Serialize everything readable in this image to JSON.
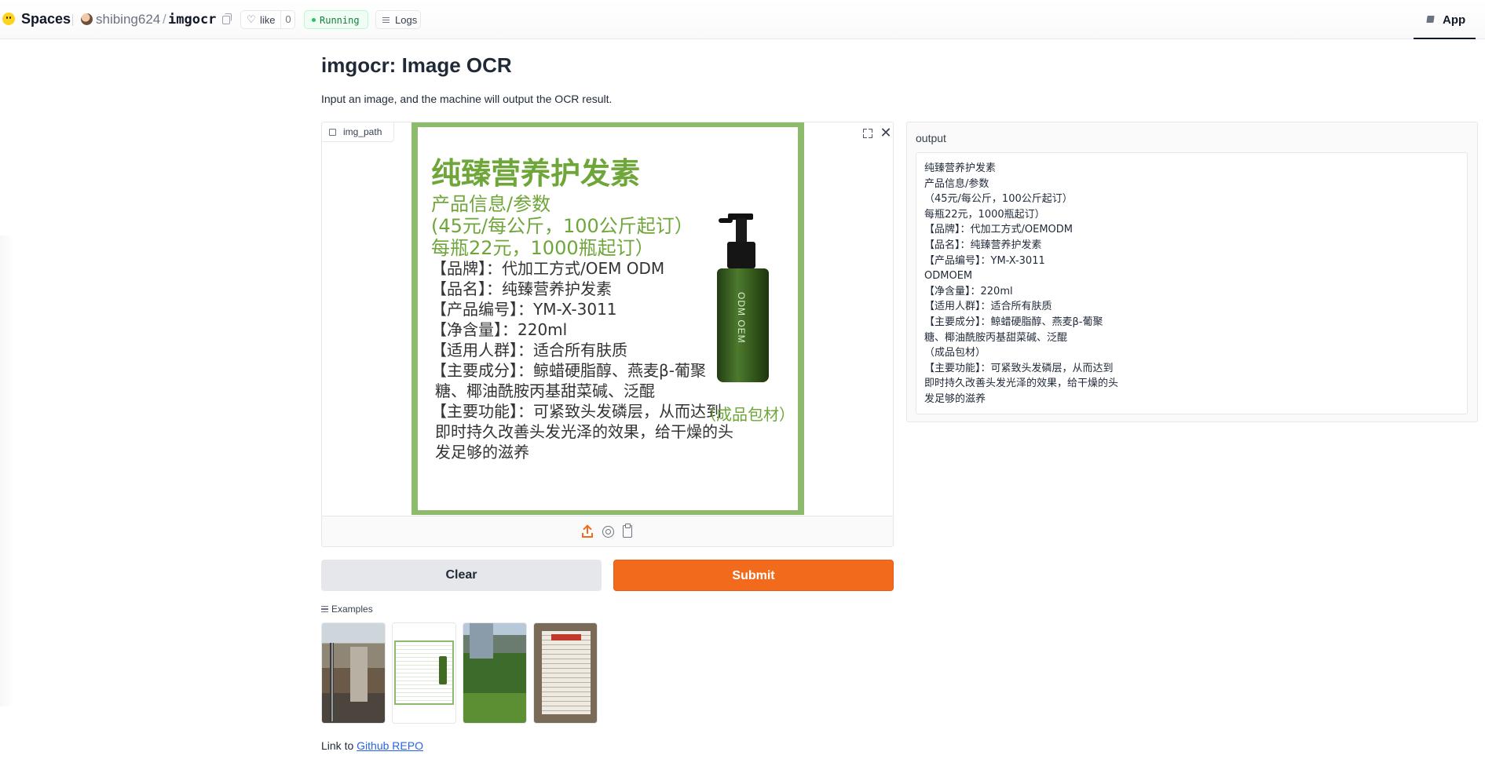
{
  "topbar": {
    "spaces_label": "Spaces",
    "owner": "shibing624",
    "separator": "/",
    "repo": "imgocr",
    "like_label": "like",
    "like_count": "0",
    "status": "Running",
    "logs_label": "Logs",
    "app_tab_label": "App"
  },
  "page": {
    "title": "imgocr: Image OCR",
    "description": "Input an image, and the machine will output the OCR result."
  },
  "input": {
    "label": "img_path",
    "preview": {
      "heading": "纯臻营养护发素",
      "green_lines": [
        "产品信息/参数",
        "(45元/每公斤，100公斤起订）",
        "每瓶22元，1000瓶起订）"
      ],
      "detail_lines": [
        "【品牌】：代加工方式/OEM ODM",
        "【品名】：纯臻营养护发素",
        "【产品编号】：YM-X-3011",
        "【净含量】：220ml",
        "【适用人群】：适合所有肤质",
        "【主要成分】：鲸蜡硬脂醇、燕麦β-葡聚",
        "糖、椰油酰胺丙基甜菜碱、泛醌",
        "【主要功能】：可紧致头发磷层，从而达到",
        "即时持久改善头发光泽的效果，给干燥的头",
        "发足够的滋养"
      ],
      "bottle_brand": "ODM OEM",
      "packaging_note": "（成品包材）"
    }
  },
  "buttons": {
    "clear": "Clear",
    "submit": "Submit"
  },
  "examples": {
    "header": "Examples"
  },
  "footer": {
    "prefix": "Link to ",
    "link_text": "Github REPO"
  },
  "output": {
    "label": "output",
    "lines": [
      "纯臻营养护发素",
      "产品信息/参数",
      "（45元/每公斤，100公斤起订）",
      "每瓶22元，1000瓶起订）",
      "【品牌】：代加工方式/OEMODM",
      "【品名】：纯臻营养护发素",
      "【产品编号】：YM-X-3011",
      "ODMOEM",
      "【净含量】：220ml",
      "【适用人群】：适合所有肤质",
      "【主要成分】：鲸蜡硬脂醇、燕麦β-葡聚",
      "糖、椰油酰胺丙基甜菜碱、泛醌",
      "（成品包材）",
      "【主要功能】：可紧致头发磷层，从而达到",
      "即时持久改善头发光泽的效果，给干燥的头",
      "发足够的滋养"
    ]
  },
  "colors": {
    "accent": "#f26b1d",
    "running_green": "#15803d",
    "product_green": "#6fa63a",
    "link_blue": "#2563eb"
  },
  "icons": {
    "logo": "huggingface-logo-icon",
    "copy": "copy-icon",
    "like": "heart-icon",
    "logs": "logs-icon",
    "app": "cube-icon",
    "image_label": "image-icon",
    "fullscreen": "fullscreen-icon",
    "clear_image": "close-icon",
    "upload": "upload-icon",
    "webcam": "webcam-icon",
    "clipboard": "clipboard-icon",
    "examples": "list-icon"
  }
}
